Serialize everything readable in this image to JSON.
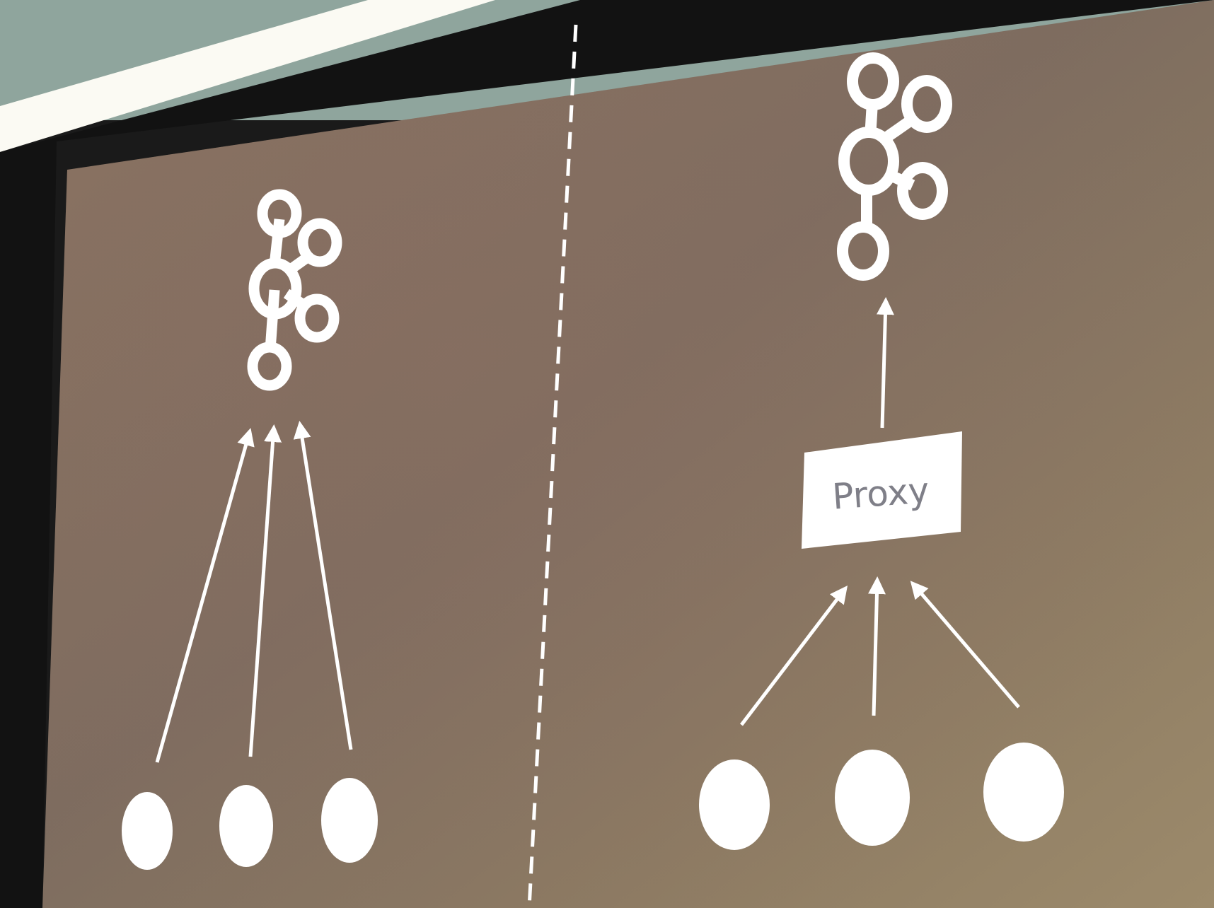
{
  "colors": {
    "screen_left": "#8a7461",
    "screen_mid": "#7d6c5f",
    "screen_right": "#8e7c63",
    "screen_bottom": "#9c8a6b",
    "ceiling": "#8fa59d",
    "light_strip": "#fbfaf3",
    "frame": "#121212",
    "ink": "#ffffff",
    "proxy_text": "#7f7f88"
  },
  "left_diagram": {
    "hub_icon": "kafka-logo-icon",
    "client_count": 3
  },
  "right_diagram": {
    "hub_icon": "kafka-logo-icon",
    "proxy_label": "Proxy",
    "client_count": 3
  },
  "divider": {
    "style": "dashed"
  }
}
